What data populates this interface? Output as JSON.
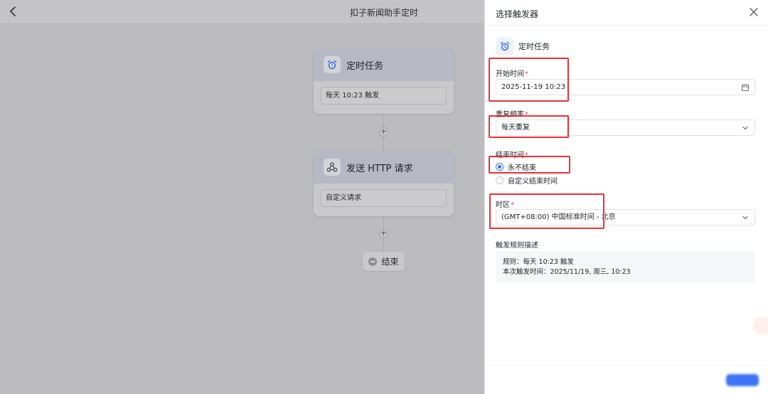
{
  "header": {
    "title": "扣子新闻助手定时"
  },
  "flow": {
    "nodes": [
      {
        "title": "定时任务",
        "field": "每天 10:23 触发",
        "icon": "alarm-clock-icon"
      },
      {
        "title": "发送 HTTP 请求",
        "field": "自定义请求",
        "icon": "http-network-icon"
      }
    ],
    "end_label": "结束"
  },
  "drawer": {
    "title": "选择触发器",
    "trigger_name": "定时任务",
    "start_time": {
      "label": "开始时间",
      "value": "2025-11-19 10:23"
    },
    "repeat": {
      "label": "重复频率",
      "value": "每天重复"
    },
    "end_time": {
      "label": "结束时间",
      "options": [
        "永不结束",
        "自定义结束时间"
      ],
      "selected": "永不结束"
    },
    "timezone": {
      "label": "时区",
      "value": "(GMT+08:00) 中国标准时间 - 北京"
    },
    "rule_desc": {
      "label": "触发规则描述",
      "line1": "规则：每天 10:23 触发",
      "line2": "本次触发时间：2025/11/19, 周三, 10:23"
    },
    "required_mark": "*"
  },
  "colors": {
    "accent": "#3370ff",
    "highlight": "#e8303a",
    "required": "#f54a45"
  }
}
